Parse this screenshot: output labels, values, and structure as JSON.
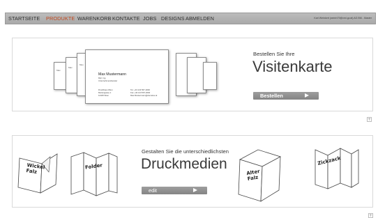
{
  "nav": {
    "items": [
      {
        "label": "STARTSEITE",
        "active": false
      },
      {
        "label": "PRODUKTE",
        "active": true
      },
      {
        "label": "WARENKORB",
        "active": false
      },
      {
        "label": "KONTAKTE",
        "active": false
      },
      {
        "label": "JOBS",
        "active": false
      },
      {
        "label": "DESIGNS",
        "active": false
      },
      {
        "label": "ABMELDEN",
        "active": false
      }
    ],
    "user_info": "Karl Weinkert (weinh79@vmi.gv.at) AG BM - Master"
  },
  "visitenkarte": {
    "intro": "Bestellen Sie Ihre",
    "title": "Visitenkarte",
    "button_label": "Bestellen",
    "card": {
      "name": "Max Mustermann",
      "line1": "Dipl. Ing.",
      "line2": "Unternehmensberater",
      "addr1": "Druckhaus Wien",
      "addr2": "Mariengasse 1",
      "addr3": "12345 Wien",
      "tel": "Tel. +43 123 567-2000",
      "fax": "Fax +43 123 567-2000",
      "mail": "Max.Mustermann@domaine.at",
      "side_name": "Max",
      "side_name2": "Mus"
    }
  },
  "druckmedien": {
    "intro": "Gestalten Sie die unterschiedlichsten",
    "title": "Druckmedien",
    "button_label": "edit",
    "folds": [
      "Wickel Falz",
      "Folder",
      "Alter Falz",
      "Zickzack"
    ]
  },
  "colors": {
    "active_nav": "#c1461b",
    "nav_bg": "#b3b3b3",
    "button_bg": "#8f8f8f"
  }
}
